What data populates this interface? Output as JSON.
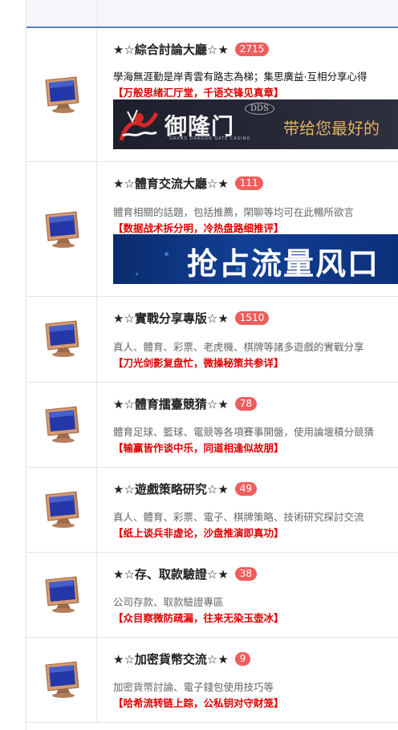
{
  "forums": [
    {
      "title": "★☆綜合討論大廳☆★",
      "count": "2715",
      "description": "學海無涯勤是岸青雲有路志為梯；集思廣益·互相分享心得",
      "slogan": "【万般思绪汇厅堂，千语交锋见真章】",
      "banner": {
        "brand": "御隆门",
        "subtext": "GRAND DRAGON GATE CASINO",
        "dds": "DDS",
        "tagline": "带给您最好的"
      }
    },
    {
      "title": "★☆體育交流大廳☆★",
      "count": "111",
      "description": "體育相關的話題，包括推薦，閑聊等均可在此暢所欲言",
      "slogan": "【数据战术拆分明，冷热盘路细推评】",
      "banner": {
        "text": "抢占流量风口"
      }
    },
    {
      "title": "★☆實戰分享專版☆★",
      "count": "1510",
      "description": "真人、體育、彩票、老虎機、棋牌等諸多遊戲的實戰分享",
      "slogan": "【刀光剑影复盘忙，微操秘策共参详】"
    },
    {
      "title": "★☆體育擂臺競猜☆★",
      "count": "78",
      "description": "體育足球、籃球、電競等各項賽事開盤，使用論壇積分競猜",
      "slogan": "【输赢皆作谈中乐，同道相逢似故朋】"
    },
    {
      "title": "★☆遊戲策略研究☆★",
      "count": "49",
      "description": "真人、體育、彩票、電子、棋牌策略、技術研究探討交流",
      "slogan": "【纸上谈兵非虚论，沙盘推演即真功】"
    },
    {
      "title": "★☆存、取款驗證☆★",
      "count": "38",
      "description": "公司存款、取款驗證專區",
      "slogan": "【众目察微防疏漏，往来无染玉壶冰】"
    },
    {
      "title": "★☆加密貨幣交流☆★",
      "count": "9",
      "description": "加密貨幣討論、電子錢包使用技巧等",
      "slogan": "【哈希流转链上踪，公私钥对守财笼】"
    }
  ]
}
